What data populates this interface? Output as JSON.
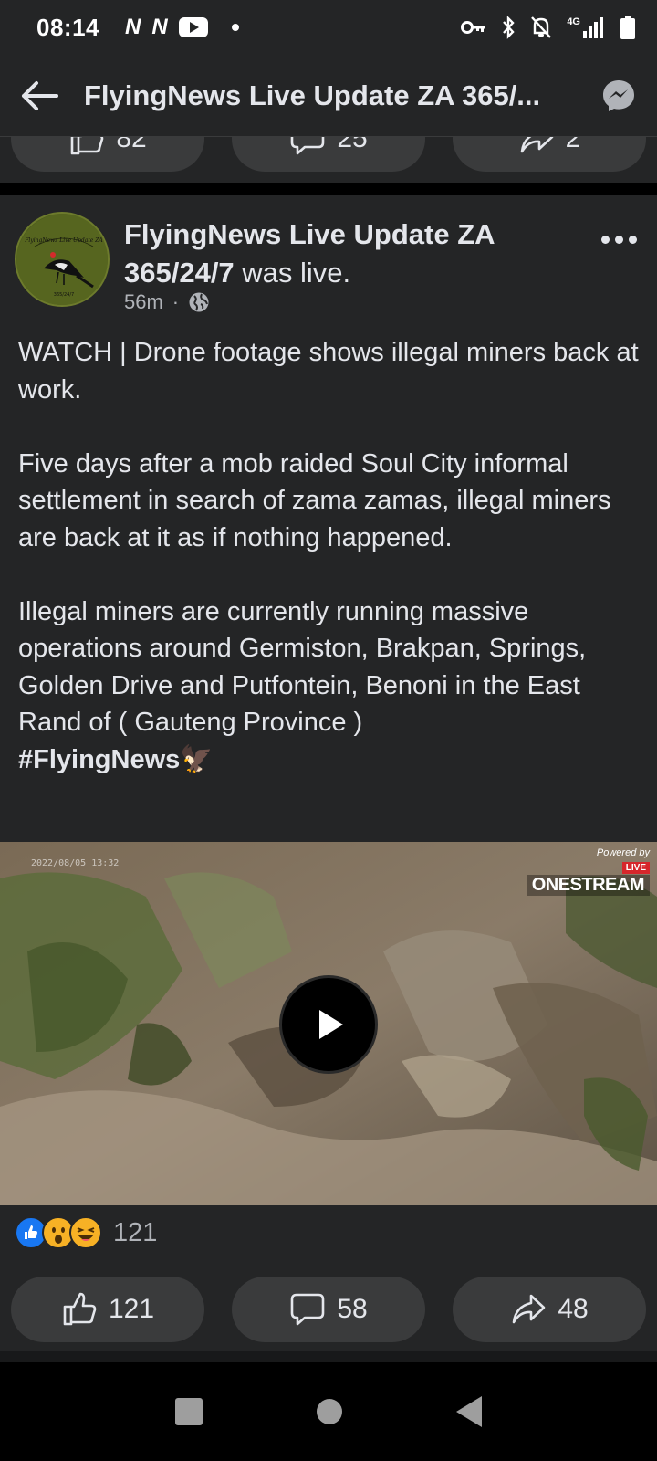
{
  "status_bar": {
    "time": "08:14",
    "notif_icons": [
      "n-icon",
      "n-icon",
      "youtube-icon"
    ],
    "network": "4G"
  },
  "header": {
    "title": "FlyingNews Live Update ZA 365/..."
  },
  "prev_post": {
    "like_count": "82",
    "comment_count": "25",
    "share_count": "2"
  },
  "post": {
    "author_name": "FlyingNews Live Update ZA 365/24/7",
    "author_action": "was live.",
    "time_ago": "56m",
    "avatar_text": "FlyingNews Live Update ZA",
    "paragraphs": [
      "WATCH | Drone footage  shows illegal miners back at work.",
      "Five days after a mob raided Soul City informal settlement in search of zama zamas, illegal miners are back at it as if nothing happened.",
      "Illegal miners are currently running massive operations around Germiston, Brakpan, Springs, Golden Drive and Putfontein, Benoni in the East Rand of ( Gauteng Province )"
    ],
    "hashtag": "#FlyingNews🦅",
    "video": {
      "powered_by": "Powered by",
      "live_label": "LIVE",
      "brand": "ONESTREAM",
      "timestamp": "2022/08/05 13:32"
    },
    "reactions": {
      "types": [
        "like",
        "wow",
        "haha"
      ],
      "total": "121"
    },
    "actions": {
      "like_count": "121",
      "comment_count": "58",
      "share_count": "48"
    }
  },
  "colors": {
    "background": "#18191a",
    "card": "#242526",
    "pill": "#3a3b3c",
    "text": "#e4e6eb",
    "secondary_text": "#b0b3b8",
    "like_blue": "#1877f2"
  }
}
